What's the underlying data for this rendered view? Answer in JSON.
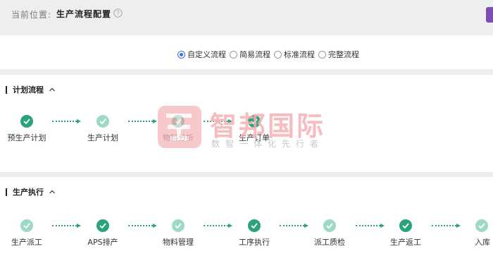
{
  "header": {
    "crumb_label": "当前位置:",
    "crumb_value": "生产流程配置",
    "help_icon": "question-circle-icon",
    "accent_color": "#7c4db5"
  },
  "flow_modes": {
    "options": [
      "自定义流程",
      "简易流程",
      "标准流程",
      "完整流程"
    ],
    "selected": "自定义流程"
  },
  "plan_section": {
    "title": "计划流程",
    "steps": [
      {
        "label": "预生产计划",
        "state": "done"
      },
      {
        "label": "生产计划",
        "state": "optional"
      },
      {
        "label": "物料分析",
        "state": "done"
      },
      {
        "label": "生产订单",
        "state": "done"
      }
    ]
  },
  "exec_section": {
    "title": "生产执行",
    "steps": [
      {
        "label": "生产派工",
        "state": "optional"
      },
      {
        "label": "APS排产",
        "state": "done"
      },
      {
        "label": "物料管理",
        "state": "optional"
      },
      {
        "label": "工序执行",
        "state": "done"
      },
      {
        "label": "派工质检",
        "state": "optional"
      },
      {
        "label": "生产返工",
        "state": "done"
      },
      {
        "label": "入库",
        "state": "optional"
      }
    ]
  },
  "watermark": {
    "title": "智邦国际",
    "subtitle": "数智一体化先行者"
  },
  "colors": {
    "step_done": "#2aa37a",
    "step_optional": "#9fd9c6",
    "radio_selected": "#3a6fd8"
  }
}
